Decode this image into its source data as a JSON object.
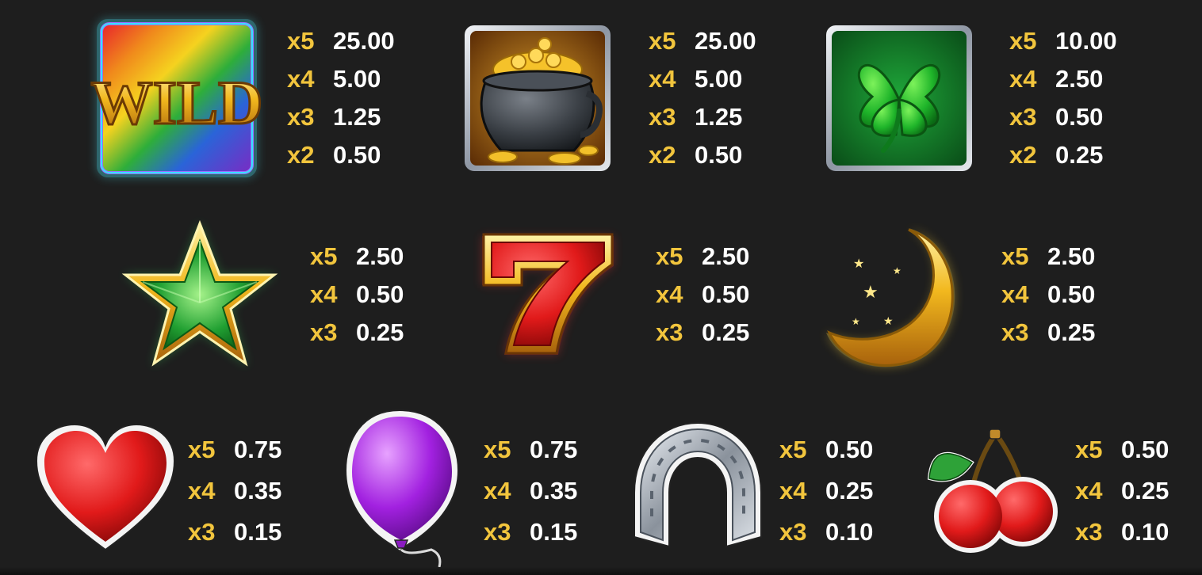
{
  "colors": {
    "background": "#1e1e1e",
    "multiplier": "#f2c53d",
    "value": "#ffffff"
  },
  "symbols": [
    {
      "name": "wild",
      "icon": "wild-rainbow-icon",
      "label": "WILD",
      "pays": [
        {
          "mult": "x5",
          "value": "25.00"
        },
        {
          "mult": "x4",
          "value": "5.00"
        },
        {
          "mult": "x3",
          "value": "1.25"
        },
        {
          "mult": "x2",
          "value": "0.50"
        }
      ]
    },
    {
      "name": "pot-of-gold",
      "icon": "pot-of-gold-icon",
      "pays": [
        {
          "mult": "x5",
          "value": "25.00"
        },
        {
          "mult": "x4",
          "value": "5.00"
        },
        {
          "mult": "x3",
          "value": "1.25"
        },
        {
          "mult": "x2",
          "value": "0.50"
        }
      ]
    },
    {
      "name": "clover",
      "icon": "four-leaf-clover-icon",
      "pays": [
        {
          "mult": "x5",
          "value": "10.00"
        },
        {
          "mult": "x4",
          "value": "2.50"
        },
        {
          "mult": "x3",
          "value": "0.50"
        },
        {
          "mult": "x2",
          "value": "0.25"
        }
      ]
    },
    {
      "name": "star",
      "icon": "green-star-icon",
      "pays": [
        {
          "mult": "x5",
          "value": "2.50"
        },
        {
          "mult": "x4",
          "value": "0.50"
        },
        {
          "mult": "x3",
          "value": "0.25"
        }
      ]
    },
    {
      "name": "seven",
      "icon": "red-seven-icon",
      "pays": [
        {
          "mult": "x5",
          "value": "2.50"
        },
        {
          "mult": "x4",
          "value": "0.50"
        },
        {
          "mult": "x3",
          "value": "0.25"
        }
      ]
    },
    {
      "name": "moon",
      "icon": "crescent-moon-icon",
      "pays": [
        {
          "mult": "x5",
          "value": "2.50"
        },
        {
          "mult": "x4",
          "value": "0.50"
        },
        {
          "mult": "x3",
          "value": "0.25"
        }
      ]
    },
    {
      "name": "heart",
      "icon": "heart-icon",
      "pays": [
        {
          "mult": "x5",
          "value": "0.75"
        },
        {
          "mult": "x4",
          "value": "0.35"
        },
        {
          "mult": "x3",
          "value": "0.15"
        }
      ]
    },
    {
      "name": "balloon",
      "icon": "balloon-icon",
      "pays": [
        {
          "mult": "x5",
          "value": "0.75"
        },
        {
          "mult": "x4",
          "value": "0.35"
        },
        {
          "mult": "x3",
          "value": "0.15"
        }
      ]
    },
    {
      "name": "horseshoe",
      "icon": "horseshoe-icon",
      "pays": [
        {
          "mult": "x5",
          "value": "0.50"
        },
        {
          "mult": "x4",
          "value": "0.25"
        },
        {
          "mult": "x3",
          "value": "0.10"
        }
      ]
    },
    {
      "name": "cherry",
      "icon": "cherry-icon",
      "pays": [
        {
          "mult": "x5",
          "value": "0.50"
        },
        {
          "mult": "x4",
          "value": "0.25"
        },
        {
          "mult": "x3",
          "value": "0.10"
        }
      ]
    }
  ]
}
